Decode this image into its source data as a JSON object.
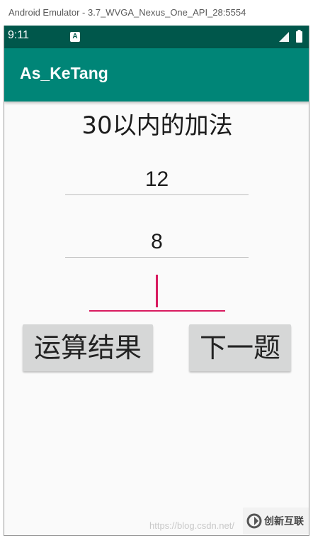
{
  "window": {
    "title": "Android Emulator - 3.7_WVGA_Nexus_One_API_28:5554"
  },
  "status_bar": {
    "time": "9:11",
    "notification_icon": "a-letter-icon",
    "notification_glyph": "A",
    "signal_icon": "signal-icon",
    "battery_icon": "battery-icon",
    "color": "#00574b"
  },
  "app_bar": {
    "title": "As_KeTang",
    "color": "#008577"
  },
  "main": {
    "heading": "30以内的加法",
    "operand1": "12",
    "operand2": "8",
    "result": "",
    "accent_color": "#d81b60",
    "buttons": {
      "calculate": "运算结果",
      "next": "下一题"
    }
  },
  "watermark": {
    "text": "https://blog.csdn.net/",
    "logo_text": "创新互联"
  }
}
